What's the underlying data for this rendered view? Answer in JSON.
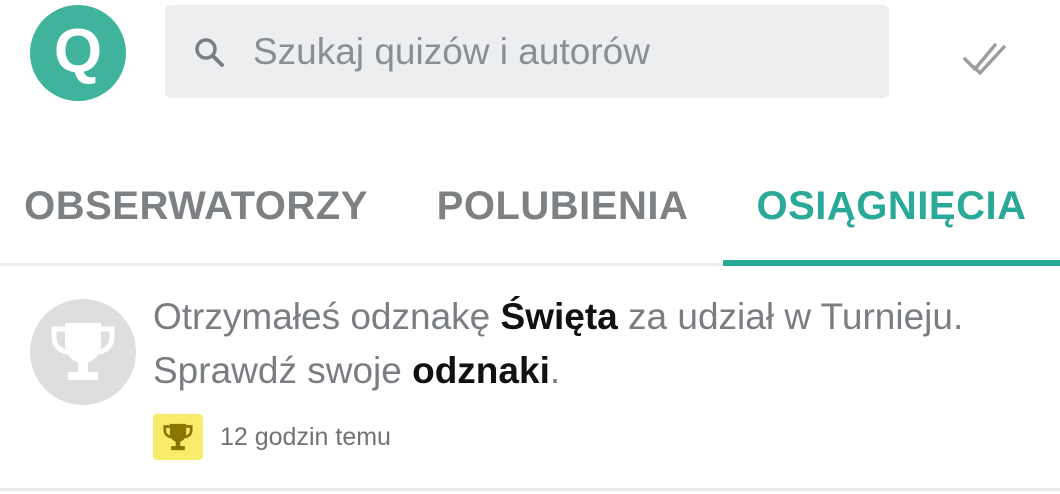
{
  "header": {
    "logo_letter": "Q",
    "search": {
      "placeholder": "Szukaj quizów i autorów",
      "icon": "search-icon"
    },
    "mark_read_icon": "double-check-icon"
  },
  "tabs": [
    {
      "label": "OBSERWATORZY",
      "active": false
    },
    {
      "label": "POLUBIENIA",
      "active": false
    },
    {
      "label": "OSIĄGNIĘCIA",
      "active": true
    }
  ],
  "notification": {
    "icon": "trophy-icon",
    "text_1": "Otrzymałeś odznakę ",
    "bold_1": "Święta",
    "text_2": " za udział w Turnieju. Sprawdź swoje ",
    "bold_2": "odznaki",
    "text_3": ".",
    "badge_icon": "trophy-small-icon",
    "time": "12 godzin temu"
  },
  "colors": {
    "accent": "#2aa998",
    "logo": "#3fb39b",
    "badge": "#f8ec6a"
  }
}
